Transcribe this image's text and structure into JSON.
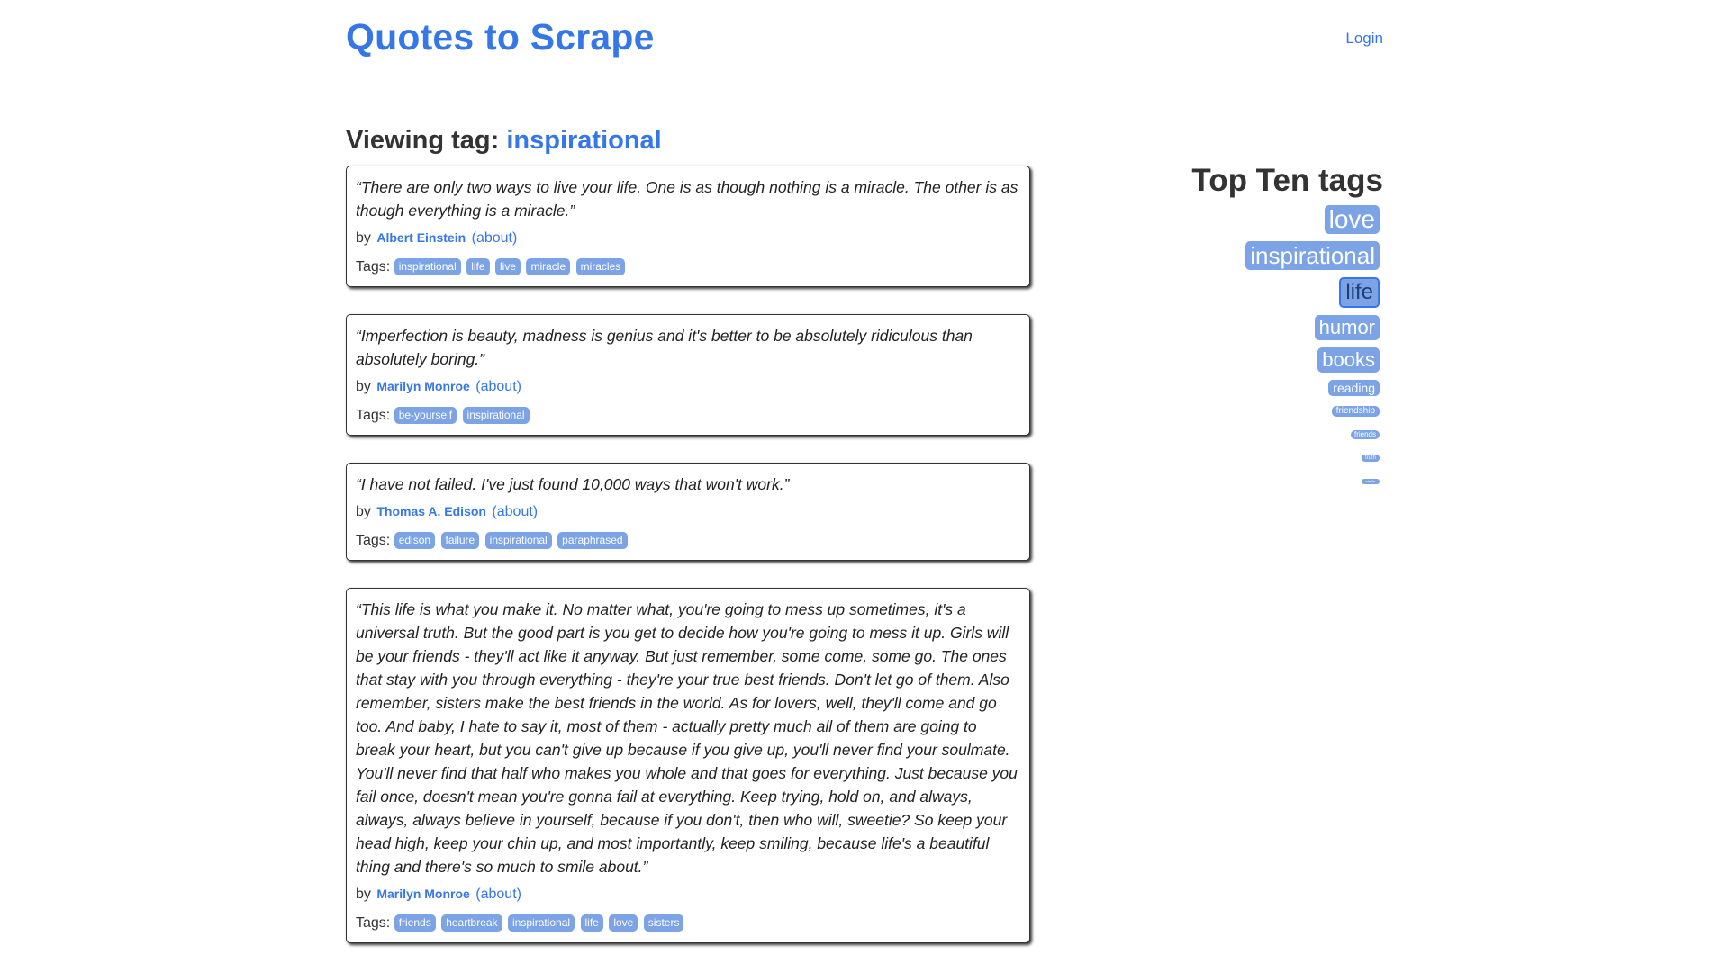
{
  "header": {
    "site_title": "Quotes to Scrape",
    "login_label": "Login"
  },
  "main": {
    "viewing_prefix": "Viewing tag: ",
    "viewing_tag": "inspirational",
    "by_label": "by",
    "about_label": "(about)",
    "tags_label": "Tags:",
    "quotes": [
      {
        "text": "“There are only two ways to live your life. One is as though nothing is a miracle. The other is as though everything is a miracle.”",
        "author": "Albert Einstein",
        "tags": [
          "inspirational",
          "life",
          "live",
          "miracle",
          "miracles"
        ]
      },
      {
        "text": "“Imperfection is beauty, madness is genius and it's better to be absolutely ridiculous than absolutely boring.”",
        "author": "Marilyn Monroe",
        "tags": [
          "be-yourself",
          "inspirational"
        ]
      },
      {
        "text": "“I have not failed. I've just found 10,000 ways that won't work.”",
        "author": "Thomas A. Edison",
        "tags": [
          "edison",
          "failure",
          "inspirational",
          "paraphrased"
        ]
      },
      {
        "text": "“This life is what you make it. No matter what, you're going to mess up sometimes, it's a universal truth. But the good part is you get to decide how you're going to mess it up. Girls will be your friends - they'll act like it anyway. But just remember, some come, some go. The ones that stay with you through everything - they're your true best friends. Don't let go of them. Also remember, sisters make the best friends in the world. As for lovers, well, they'll come and go too. And baby, I hate to say it, most of them - actually pretty much all of them are going to break your heart, but you can't give up because if you give up, you'll never find your soulmate. You'll never find that half who makes you whole and that goes for everything. Just because you fail once, doesn't mean you're gonna fail at everything. Keep trying, hold on, and always, always, always believe in yourself, because if you don't, then who will, sweetie? So keep your head high, keep your chin up, and most importantly, keep smiling, because life's a beautiful thing and there's so much to smile about.”",
        "author": "Marilyn Monroe",
        "tags": [
          "friends",
          "heartbreak",
          "inspirational",
          "life",
          "love",
          "sisters"
        ]
      }
    ]
  },
  "sidebar": {
    "title": "Top Ten tags",
    "tags": [
      {
        "label": "love",
        "size": "t-28"
      },
      {
        "label": "inspirational",
        "size": "t-26"
      },
      {
        "label": "life",
        "size": "t-24"
      },
      {
        "label": "humor",
        "size": "t-22"
      },
      {
        "label": "books",
        "size": "t-22"
      },
      {
        "label": "reading",
        "size": "t-14"
      },
      {
        "label": "friendship",
        "size": "t-10"
      },
      {
        "label": "friends",
        "size": "t-8"
      },
      {
        "label": "truth",
        "size": "t-6"
      },
      {
        "label": "simile",
        "size": "t-4"
      }
    ]
  },
  "colors": {
    "accent": "#3677e8",
    "tag_background": "#7ca3e6",
    "text": "#333333"
  }
}
